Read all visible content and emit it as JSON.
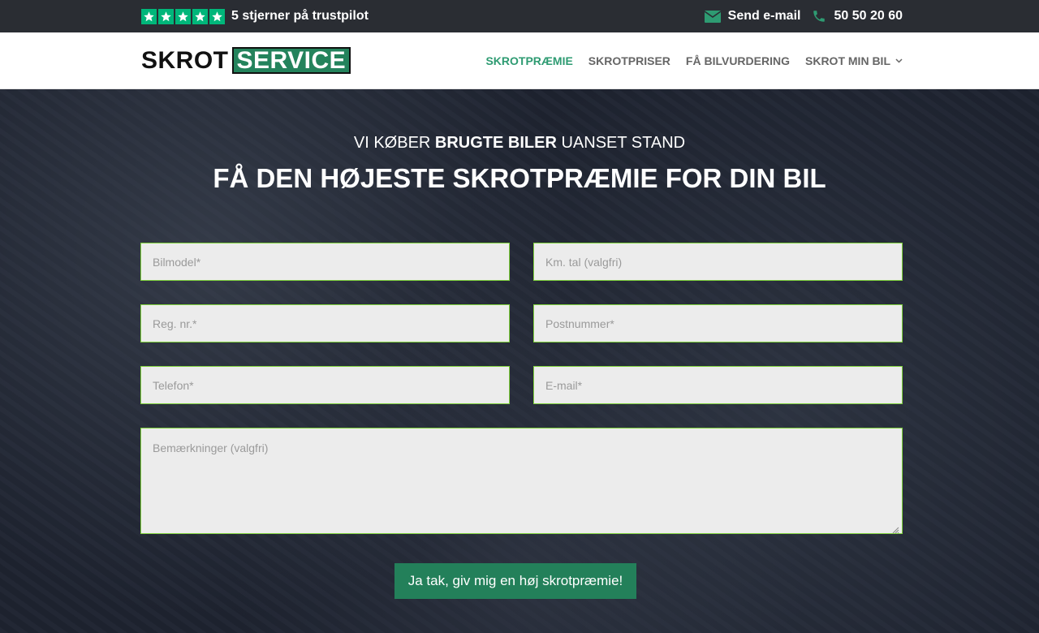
{
  "topbar": {
    "trust_text": "5 stjerner på trustpilot",
    "stars": 5,
    "email_label": "Send e-mail",
    "phone_label": "50 50 20 60"
  },
  "header": {
    "logo_part1": "SKROT",
    "logo_part2": "SERVICE",
    "nav": [
      {
        "label": "SKROTPRÆMIE",
        "active": true
      },
      {
        "label": "SKROTPRISER",
        "active": false
      },
      {
        "label": "FÅ BILVURDERING",
        "active": false
      },
      {
        "label": "SKROT MIN BIL",
        "active": false
      }
    ]
  },
  "hero": {
    "sub_prefix": "VI KØBER ",
    "sub_bold": "BRUGTE BILER",
    "sub_suffix": " UANSET STAND",
    "title": "FÅ DEN HØJESTE SKROTPRÆMIE FOR DIN BIL"
  },
  "form": {
    "bilmodel_placeholder": "Bilmodel*",
    "km_placeholder": "Km. tal (valgfri)",
    "regnr_placeholder": "Reg. nr.*",
    "postnummer_placeholder": "Postnummer*",
    "telefon_placeholder": "Telefon*",
    "email_placeholder": "E-mail*",
    "bemaerkninger_placeholder": "Bemærkninger (valgfri)",
    "submit_label": "Ja tak, giv mig en høj skrotpræmie!"
  },
  "colors": {
    "brand_green": "#24835c",
    "trustpilot_green": "#00b67a",
    "field_border": "#7fd23c"
  }
}
